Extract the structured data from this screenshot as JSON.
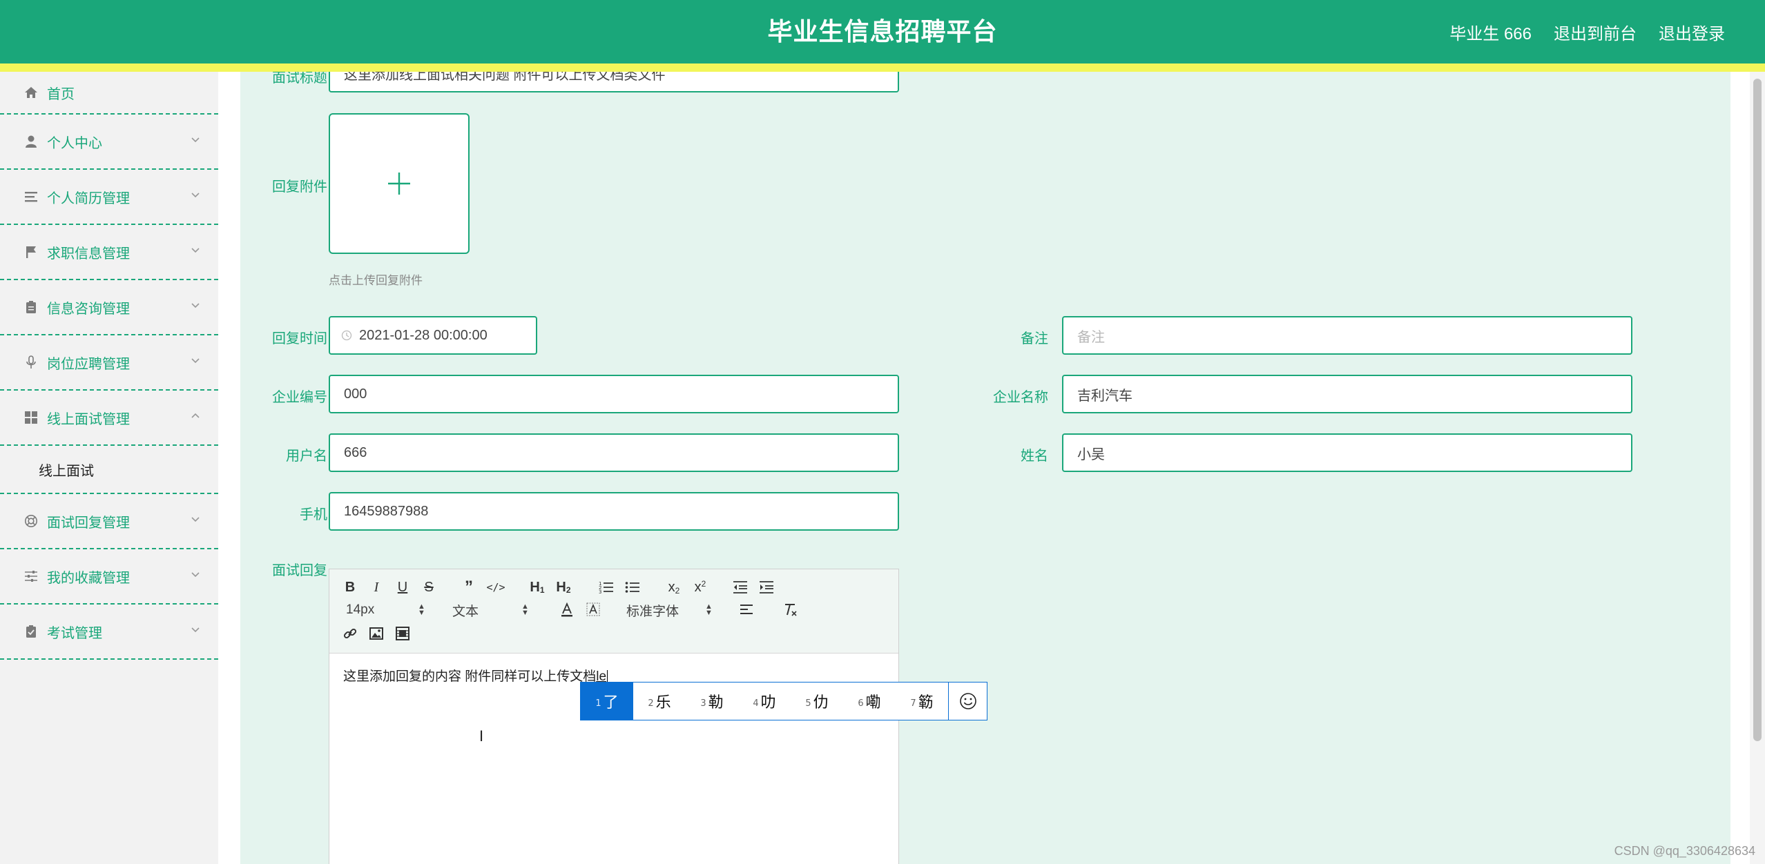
{
  "header": {
    "title": "毕业生信息招聘平台",
    "user_label": "毕业生 666",
    "to_front_label": "退出到前台",
    "logout_label": "退出登录"
  },
  "colors": {
    "brand": "#1aa77a",
    "strip": "#f2f65a",
    "content_bg": "#e4f4ee",
    "ime_accent": "#0a6fd4"
  },
  "sidebar": {
    "items": [
      {
        "label": "首页",
        "icon": "home-icon"
      },
      {
        "label": "个人中心",
        "icon": "user-icon"
      },
      {
        "label": "个人简历管理",
        "icon": "list-icon"
      },
      {
        "label": "求职信息管理",
        "icon": "flag-icon"
      },
      {
        "label": "信息咨询管理",
        "icon": "clipboard-icon"
      },
      {
        "label": "岗位应聘管理",
        "icon": "microphone-icon"
      },
      {
        "label": "线上面试管理",
        "icon": "grid-icon"
      },
      {
        "label": "面试回复管理",
        "icon": "lifebuoy-icon"
      },
      {
        "label": "我的收藏管理",
        "icon": "sliders-icon"
      },
      {
        "label": "考试管理",
        "icon": "checklist-icon"
      }
    ],
    "sub_item": "线上面试"
  },
  "form": {
    "interview_title": {
      "label": "面试标题",
      "value": "这里添加线上面试相关问题 附件可以上传文档类文件"
    },
    "attachment": {
      "label": "回复附件",
      "hint": "点击上传回复附件"
    },
    "reply_time": {
      "label": "回复时间",
      "value": "2021-01-28 00:00:00"
    },
    "remark": {
      "label": "备注",
      "placeholder": "备注"
    },
    "company_id": {
      "label": "企业编号",
      "value": "000"
    },
    "company_name": {
      "label": "企业名称",
      "value": "吉利汽车"
    },
    "username": {
      "label": "用户名",
      "value": "666"
    },
    "name": {
      "label": "姓名",
      "value": "小吴"
    },
    "phone": {
      "label": "手机",
      "value": "16459887988"
    },
    "reply": {
      "label": "面试回复"
    }
  },
  "editor": {
    "font_size": "14px",
    "paragraph": "文本",
    "font_family": "标准字体",
    "content": "这里添加回复的内容 附件同样可以上传文档",
    "composing": "le"
  },
  "ime": {
    "candidates": [
      {
        "num": "1",
        "char": "了"
      },
      {
        "num": "2",
        "char": "乐"
      },
      {
        "num": "3",
        "char": "勒"
      },
      {
        "num": "4",
        "char": "叻"
      },
      {
        "num": "5",
        "char": "仂"
      },
      {
        "num": "6",
        "char": "嘞"
      },
      {
        "num": "7",
        "char": "簕"
      }
    ],
    "emoji_icon": "smiley-icon"
  },
  "watermark": "CSDN @qq_3306428634"
}
